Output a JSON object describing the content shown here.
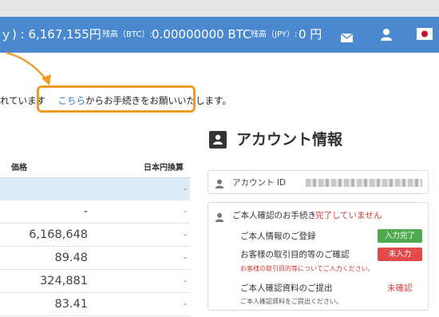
{
  "header": {
    "total_value": "ｙ) : 6,167,155円",
    "btc_balance_label": "残高（BTC）:",
    "btc_balance_value": "0.00000000 BTC",
    "jpy_balance_label": "残高（JPY）:",
    "jpy_balance_value": "0 円"
  },
  "notice": {
    "prefix": "れています",
    "link_text": "こちら",
    "suffix": "からお手続きをお願いいたします。"
  },
  "table": {
    "headers": {
      "price": "価格",
      "jpy": "日本円換算"
    },
    "rows": [
      {
        "price": "",
        "jpy": "-"
      },
      {
        "price": "-",
        "jpy": "-"
      },
      {
        "price": "6,168,648",
        "jpy": "-"
      },
      {
        "price": "89.48",
        "jpy": "-"
      },
      {
        "price": "324,881",
        "jpy": "-"
      },
      {
        "price": "83.41",
        "jpy": "-"
      }
    ]
  },
  "account": {
    "title": "アカウント情報",
    "id_label": "アカウント ID",
    "verification": {
      "label": "ご本人確認のお手続き",
      "status": "完了していません",
      "items": [
        {
          "label": "ご本人情報のご登録",
          "badge": "入力完了",
          "color": "#4faa4f"
        },
        {
          "label": "お客様の取引目的等のご確認",
          "badge": "未入力",
          "color": "#e24b4b",
          "note": "お客様の取引目的等についてご入力ください。"
        },
        {
          "label": "ご本人確認資料のご提出",
          "status": "未確認",
          "note": "ご本人確認資料をご提出ください。"
        }
      ]
    }
  },
  "colors": {
    "header_bg": "#4a88cf",
    "highlight": "#ef9b25",
    "link": "#2f7ad0",
    "alert": "#d13b3b"
  }
}
